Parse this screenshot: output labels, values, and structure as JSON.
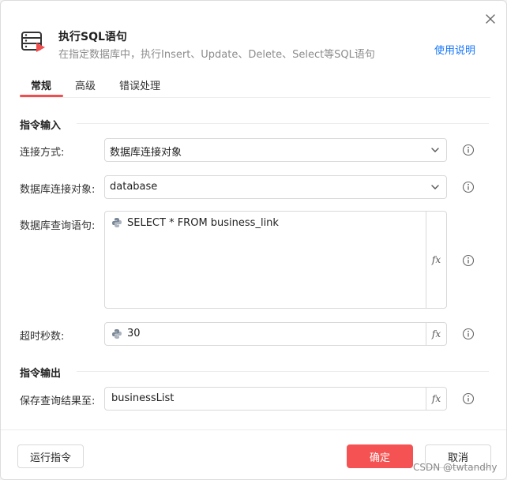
{
  "dialog": {
    "title": "执行SQL语句",
    "subtitle": "在指定数据库中，执行Insert、Update、Delete、Select等SQL语句",
    "help_label": "使用说明",
    "icon": "database-exec-icon",
    "close_icon": "close-icon"
  },
  "tabs": [
    {
      "label": "常规",
      "active": true
    },
    {
      "label": "高级",
      "active": false
    },
    {
      "label": "错误处理",
      "active": false
    }
  ],
  "sections": {
    "input": "指令输入",
    "output": "指令输出"
  },
  "fields": {
    "connection_mode": {
      "label": "连接方式:",
      "value": "数据库连接对象"
    },
    "db_object": {
      "label": "数据库连接对象:",
      "value": "database"
    },
    "query": {
      "label": "数据库查询语句:",
      "value": "SELECT * FROM business_link"
    },
    "timeout": {
      "label": "超时秒数:",
      "value": "30"
    },
    "save_result": {
      "label": "保存查询结果至:",
      "value": "businessList"
    }
  },
  "fx_label": "fx",
  "buttons": {
    "run": "运行指令",
    "ok": "确定",
    "cancel": "取消"
  },
  "watermark": "CSDN @twtandhy",
  "colors": {
    "accent": "#f55353",
    "link": "#1677ff"
  }
}
